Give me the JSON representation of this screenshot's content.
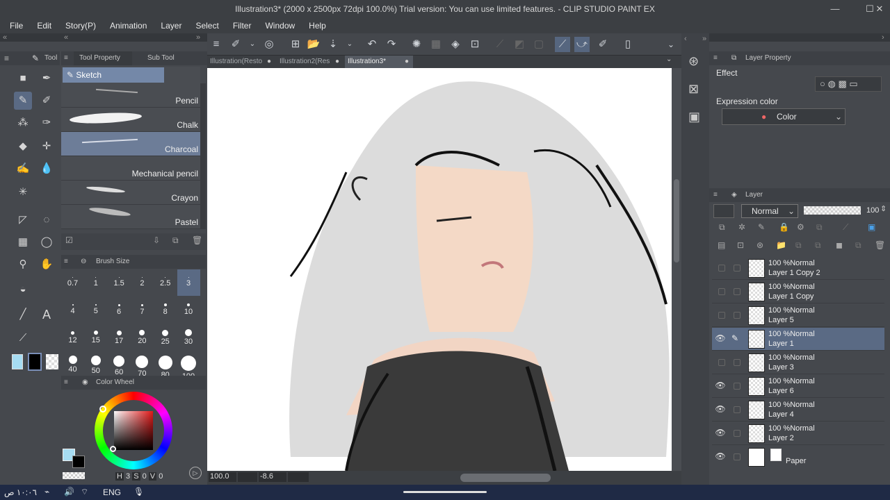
{
  "app": {
    "title": "Illustration3* (2000 x 2500px 72dpi 100.0%)  Trial version: You can use limited features. - CLIP STUDIO PAINT EX"
  },
  "menu": [
    "File",
    "Edit",
    "Story(P)",
    "Animation",
    "Layer",
    "Select",
    "Filter",
    "Window",
    "Help"
  ],
  "panels": {
    "tool": "Tool",
    "tool_property": "Tool Property",
    "sub_tool": "Sub Tool",
    "brush_size": "Brush Size",
    "color_wheel": "Color Wheel",
    "layer_property": "Layer Property",
    "layer": "Layer"
  },
  "subtool": {
    "group": "Sketch",
    "items": [
      "Pencil",
      "Chalk",
      "Charcoal",
      "Mechanical pencil",
      "Crayon",
      "Pastel"
    ],
    "selected": "Charcoal"
  },
  "brush_sizes": [
    "0.7",
    "1",
    "1.5",
    "2",
    "2.5",
    "3",
    "4",
    "5",
    "6",
    "7",
    "8",
    "10",
    "12",
    "15",
    "17",
    "20",
    "25",
    "30",
    "40",
    "50",
    "60",
    "70",
    "80",
    "100"
  ],
  "brush_selected": "3",
  "color_readout": {
    "h": "3",
    "s": "0",
    "v": "0"
  },
  "doc_tabs": [
    "Illustration(Resto",
    "Illustration2(Res",
    "Illustration3*"
  ],
  "status": {
    "zoom": "100.0",
    "angle": "-8.6"
  },
  "layer_property": {
    "effect_label": "Effect",
    "expression_label": "Expression color",
    "expression_value": "Color"
  },
  "layer_panel": {
    "blend_mode": "Normal",
    "opacity": "100"
  },
  "layers": [
    {
      "mode": "100 %Normal",
      "name": "Layer 1 Copy 2",
      "visible": false,
      "selected": false
    },
    {
      "mode": "100 %Normal",
      "name": "Layer 1 Copy",
      "visible": false,
      "selected": false
    },
    {
      "mode": "100 %Normal",
      "name": "Layer 5",
      "visible": false,
      "selected": false
    },
    {
      "mode": "100 %Normal",
      "name": "Layer 1",
      "visible": true,
      "selected": true
    },
    {
      "mode": "100 %Normal",
      "name": "Layer 3",
      "visible": false,
      "selected": false
    },
    {
      "mode": "100 %Normal",
      "name": "Layer 6",
      "visible": true,
      "selected": false
    },
    {
      "mode": "100 %Normal",
      "name": "Layer 4",
      "visible": true,
      "selected": false
    },
    {
      "mode": "100 %Normal",
      "name": "Layer 2",
      "visible": true,
      "selected": false
    }
  ],
  "paper": {
    "name": "Paper"
  },
  "taskbar": {
    "time": "١٠:٠٦ ص",
    "lang": "ENG"
  },
  "colors": {
    "selected_layer": "#5a6a84",
    "accent": "#7a8fb8",
    "panel": "#45484d",
    "foreground": "#a6dcf2",
    "background": "#000000"
  }
}
